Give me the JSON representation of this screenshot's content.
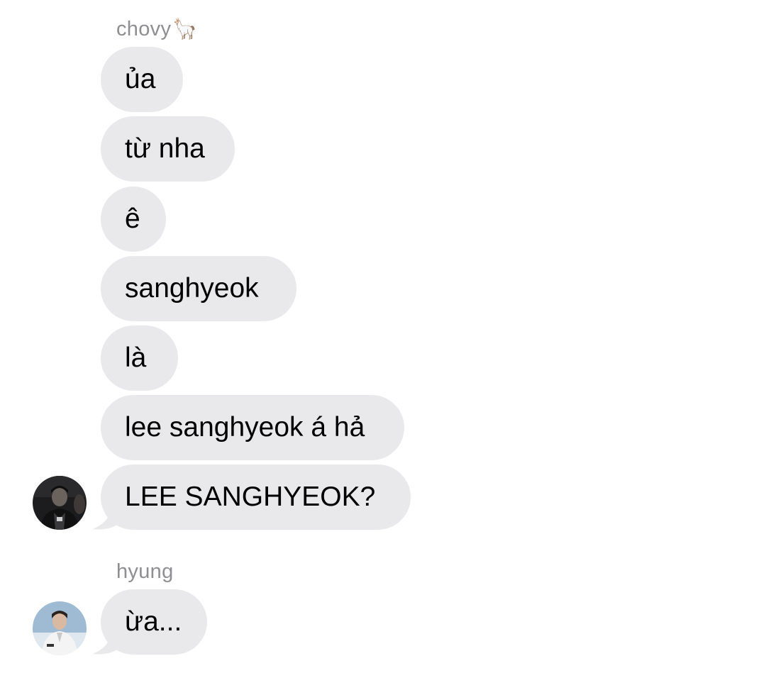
{
  "groups": [
    {
      "sender": "chovy",
      "sender_emoji": "🦙",
      "messages": [
        "ủa",
        "từ nha",
        "ê",
        "sanghyeok",
        "là",
        "lee sanghyeok á hả",
        "LEE SANGHYEOK?"
      ]
    },
    {
      "sender": "hyung",
      "messages": [
        "ừa..."
      ]
    }
  ],
  "colors": {
    "bubble_bg": "#e9e9eb",
    "sender_name": "#8e8e93",
    "text": "#000000"
  },
  "icons": {
    "chovy_avatar": "avatar-photo-dark",
    "hyung_avatar": "avatar-photo-light"
  }
}
